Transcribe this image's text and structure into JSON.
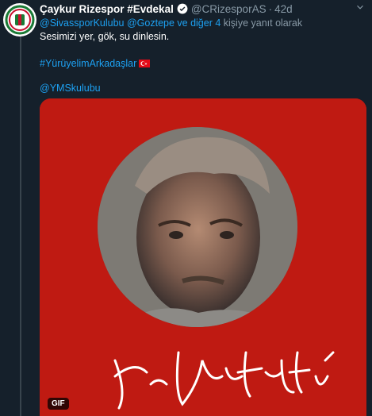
{
  "tweet": {
    "author_name": "Çaykur Rizespor #Evdekal",
    "handle": "@CRizesporAS",
    "separator": "·",
    "time": "42d",
    "reply": {
      "mention1": "@SivassporKulubu",
      "mention2": "@Goztepe ve diğer 4",
      "suffix": "kişiye yanıt olarak"
    },
    "line1": "Sesimizi yer, gök, su dinlesin.",
    "hashtag": "#YürüyelimArkadaşlar",
    "mention_club": "@YMSkulubu",
    "gif_label": "GIF"
  },
  "colors": {
    "background": "#15202b",
    "link": "#1da1f2",
    "muted": "#8899a6",
    "media_red": "#bf1a12"
  },
  "icons": [
    "verified-badge-icon",
    "chevron-down-icon",
    "turkish-flag-icon"
  ]
}
